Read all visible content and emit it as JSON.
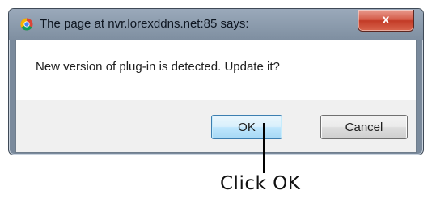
{
  "dialog": {
    "title": "The page at nvr.lorexddns.net:85 says:",
    "app_icon": "chrome-icon",
    "close_label": "x",
    "message": "New version of plug-in is detected. Update it?",
    "ok_label": "OK",
    "cancel_label": "Cancel"
  },
  "annotation": {
    "text": "Click OK"
  }
}
